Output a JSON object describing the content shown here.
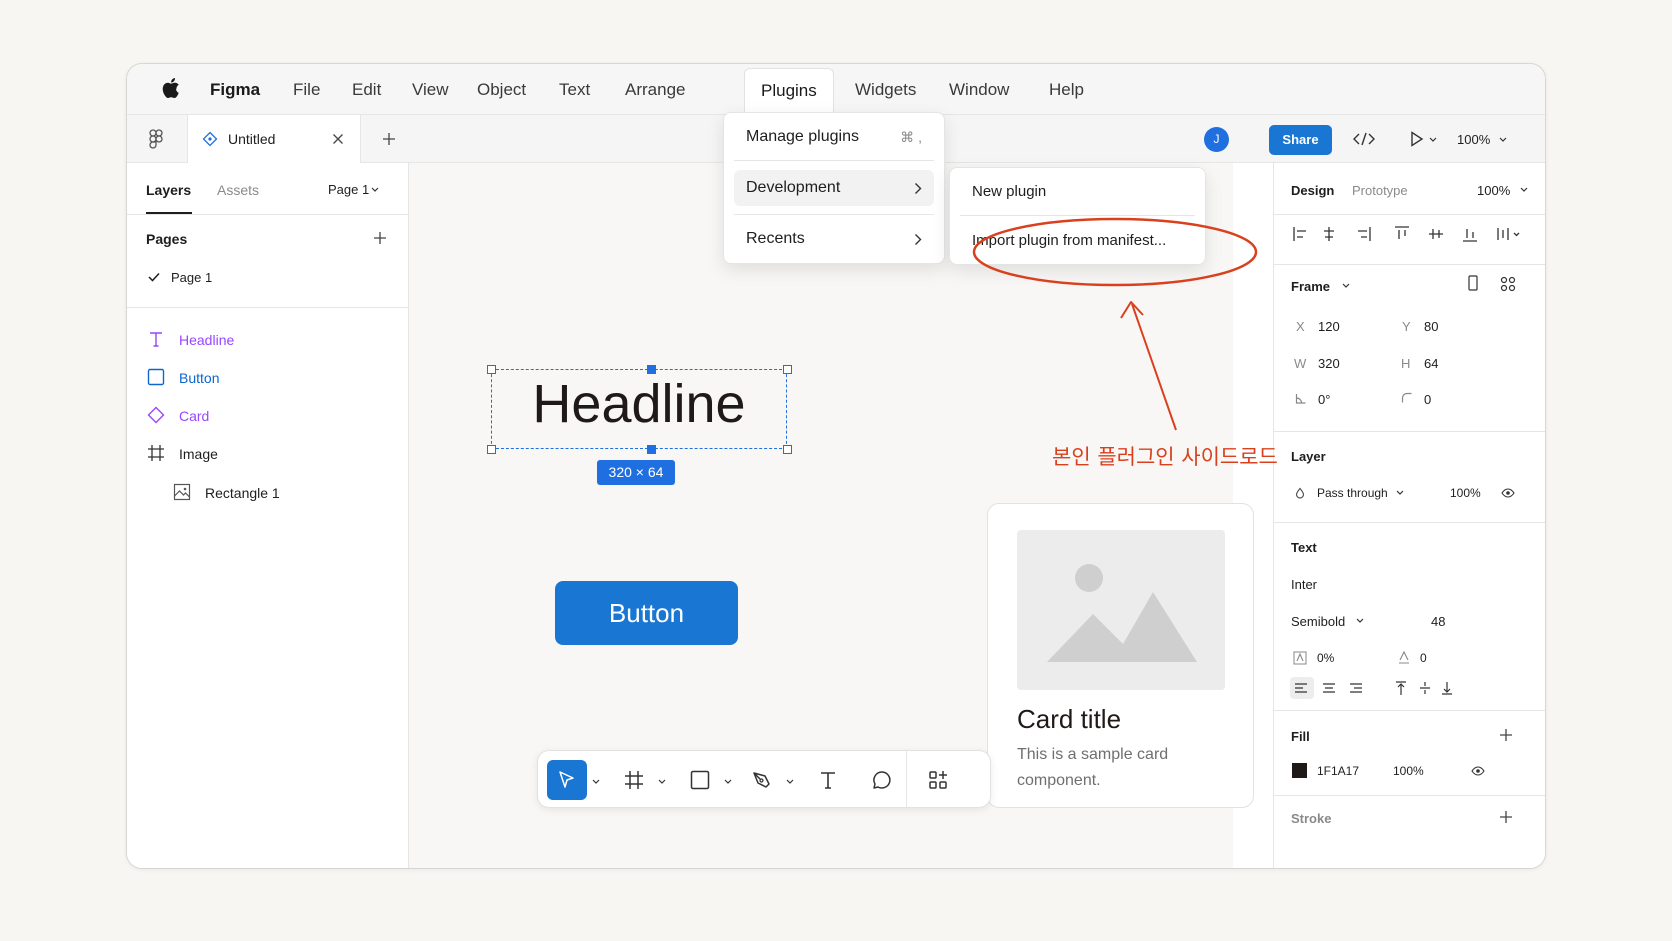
{
  "menubar": {
    "app_name": "Figma",
    "items": [
      "File",
      "Edit",
      "View",
      "Object",
      "Text",
      "Arrange",
      "Plugins",
      "Widgets",
      "Window",
      "Help"
    ],
    "active_item": "Plugins"
  },
  "tabbar": {
    "tab_title": "Untitled",
    "avatar_initial": "J",
    "share_label": "Share",
    "zoom": "100%"
  },
  "left_panel": {
    "tabs": [
      "Layers",
      "Assets"
    ],
    "page_selector": "Page 1",
    "pages_heading": "Pages",
    "pages": [
      "Page 1"
    ],
    "layers": [
      {
        "name": "Headline",
        "icon": "text-icon",
        "color": "#9747ff"
      },
      {
        "name": "Button",
        "icon": "frame-rect-icon",
        "color": "#0d66d0"
      },
      {
        "name": "Card",
        "icon": "component-diamond-icon",
        "color": "#9747ff"
      },
      {
        "name": "Image",
        "icon": "frame-hash-icon",
        "color": "#1e1e1e"
      },
      {
        "name": "Rectangle 1",
        "icon": "image-icon",
        "color": "#1e1e1e"
      }
    ]
  },
  "plugins_menu": {
    "items": [
      {
        "label": "Manage plugins",
        "shortcut": "⌘ ,"
      },
      {
        "label": "Development",
        "submenu": true
      },
      {
        "label": "Recents",
        "submenu": true
      }
    ]
  },
  "development_submenu": {
    "items": [
      "New plugin",
      "Import plugin from manifest..."
    ]
  },
  "annotation": {
    "text": "본인 플러그인 사이드로드",
    "color": "#d9411e"
  },
  "canvas": {
    "headline_text": "Headline",
    "dimension_badge": "320 × 64",
    "button_text": "Button",
    "card_title": "Card title",
    "card_body": "This is a sample card component."
  },
  "right_panel": {
    "tabs": [
      "Design",
      "Prototype"
    ],
    "zoom": "100%",
    "frame": {
      "heading": "Frame",
      "x_label": "X",
      "x": "120",
      "y_label": "Y",
      "y": "80",
      "w_label": "W",
      "w": "320",
      "h_label": "H",
      "h": "64",
      "rotation": "0°",
      "radius": "0"
    },
    "layer": {
      "heading": "Layer",
      "blend": "Pass through",
      "opacity": "100%"
    },
    "text": {
      "heading": "Text",
      "font": "Inter",
      "weight": "Semibold",
      "size": "48",
      "letter_spacing": "0%",
      "line_height": "0"
    },
    "fill": {
      "heading": "Fill",
      "hex": "1F1A17",
      "opacity": "100%",
      "swatch": "#1f1a17"
    },
    "stroke": {
      "heading": "Stroke"
    }
  },
  "colors": {
    "accent": "#1976d2",
    "selection": "#1f6fe0"
  }
}
